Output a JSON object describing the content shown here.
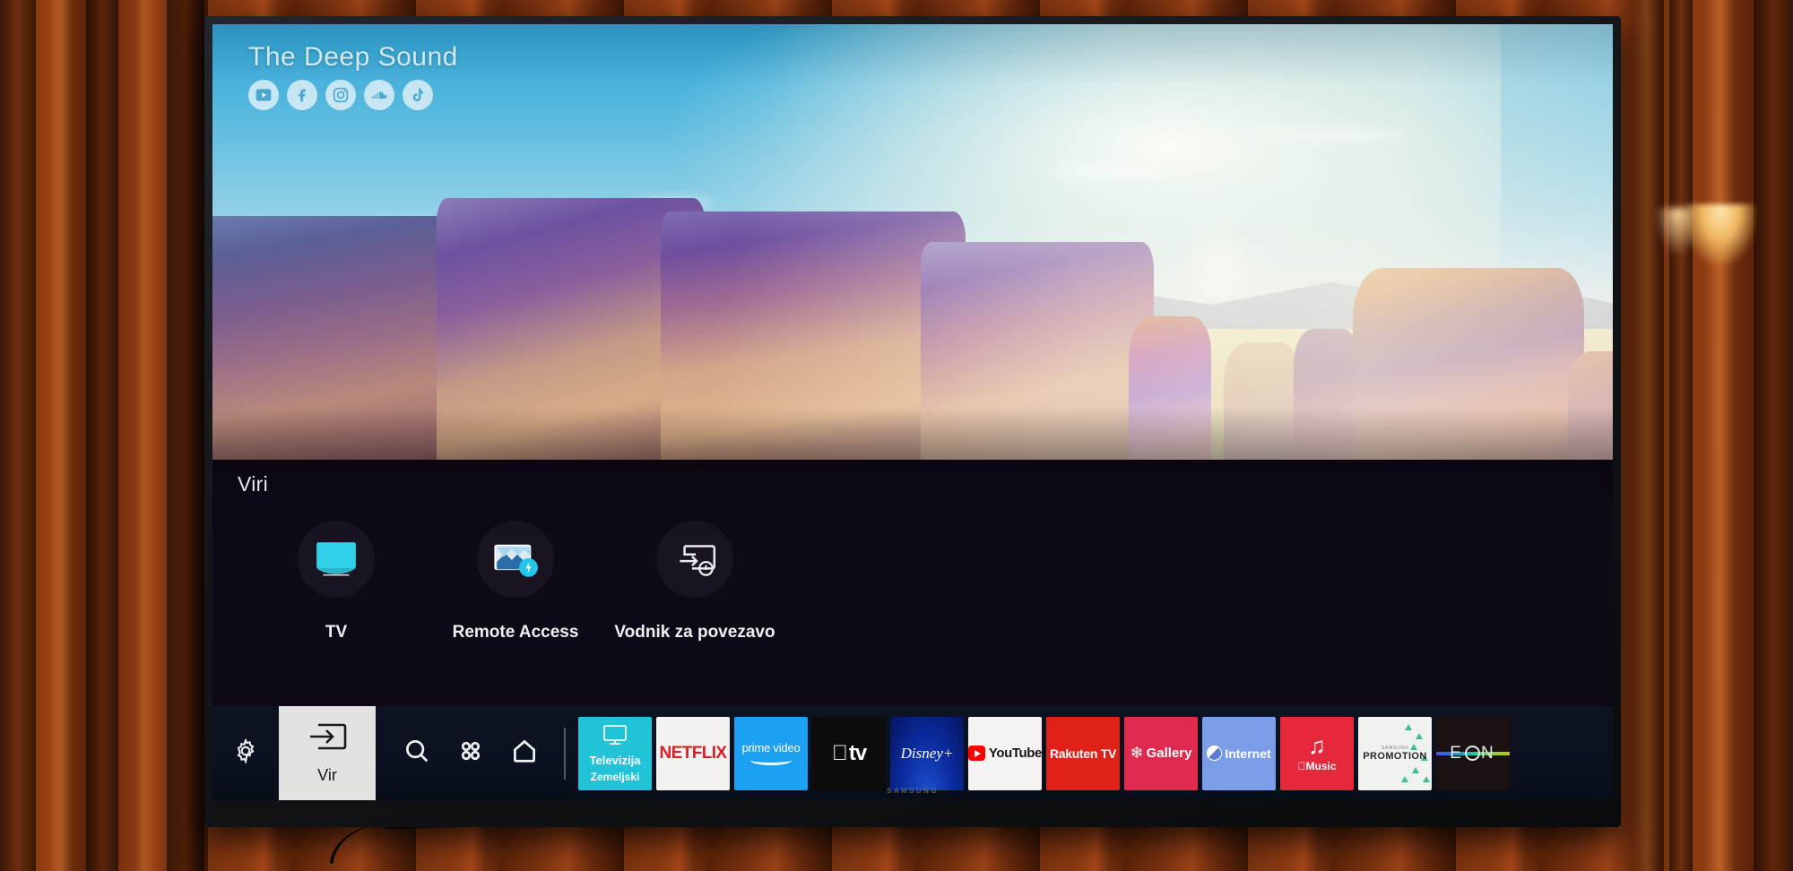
{
  "scene": {
    "device": "samsung-smart-tv",
    "brand_label": "SAMSUNG",
    "wall": "wooden-slat-wall"
  },
  "video": {
    "watermark_title": "The Deep Sound",
    "socials": [
      {
        "name": "youtube-icon",
        "label": "YouTube"
      },
      {
        "name": "facebook-icon",
        "label": "Facebook"
      },
      {
        "name": "instagram-icon",
        "label": "Instagram"
      },
      {
        "name": "soundcloud-icon",
        "label": "SoundCloud"
      },
      {
        "name": "tiktok-icon",
        "label": "TikTok"
      }
    ],
    "scene_description": "Meteora rock formations at sunrise"
  },
  "sources": {
    "title": "Viri",
    "items": [
      {
        "label": "TV",
        "icon": "tv-screen-icon"
      },
      {
        "label": "Remote Access",
        "icon": "remote-access-icon"
      },
      {
        "label": "Vodnik za povezavo",
        "icon": "connection-guide-icon"
      }
    ]
  },
  "appbar": {
    "settings": {
      "label": "Settings",
      "icon": "gear-icon"
    },
    "source_tile": {
      "label": "Vir",
      "icon": "input-source-icon",
      "selected": true
    },
    "nav": [
      {
        "label": "Search",
        "icon": "search-icon"
      },
      {
        "label": "Apps",
        "icon": "apps-grid-icon"
      },
      {
        "label": "Home",
        "icon": "home-icon"
      }
    ],
    "apps": [
      {
        "id": "televizija",
        "line1": "Televizija",
        "line2": "Zemeljski",
        "color": "#20c4d6"
      },
      {
        "id": "netflix",
        "label": "NETFLIX",
        "color": "#f3f2f0"
      },
      {
        "id": "prime-video",
        "label": "prime video",
        "color": "#1ba0f2"
      },
      {
        "id": "apple-tv",
        "label": "tv",
        "glyph": "",
        "color": "#0c0c0c"
      },
      {
        "id": "disney-plus",
        "label": "Disney+",
        "color": "#0b2a9c"
      },
      {
        "id": "youtube",
        "label": "YouTube",
        "color": "#f4f3f1"
      },
      {
        "id": "rakuten-tv",
        "label": "Rakuten TV",
        "color": "#e02117"
      },
      {
        "id": "gallery",
        "label": "Gallery",
        "color": "#e0294f"
      },
      {
        "id": "internet",
        "label": "Internet",
        "color": "#7b9de8"
      },
      {
        "id": "apple-music",
        "label": "Music",
        "color": "#e6283c"
      },
      {
        "id": "samsung-promotion",
        "brand": "SAMSUNG",
        "label": "PROMOTION",
        "color": "#f0f2f0"
      },
      {
        "id": "eon",
        "label": "EON",
        "color": "#1a1210"
      }
    ]
  }
}
